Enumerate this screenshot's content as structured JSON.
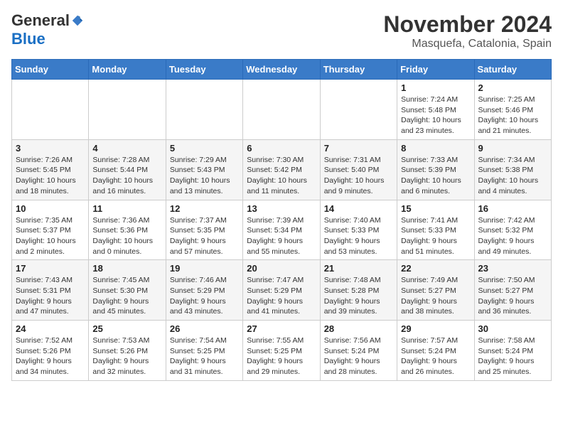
{
  "logo": {
    "general": "General",
    "blue": "Blue"
  },
  "header": {
    "month": "November 2024",
    "location": "Masquefa, Catalonia, Spain"
  },
  "weekdays": [
    "Sunday",
    "Monday",
    "Tuesday",
    "Wednesday",
    "Thursday",
    "Friday",
    "Saturday"
  ],
  "weeks": [
    [
      {
        "day": "",
        "info": ""
      },
      {
        "day": "",
        "info": ""
      },
      {
        "day": "",
        "info": ""
      },
      {
        "day": "",
        "info": ""
      },
      {
        "day": "",
        "info": ""
      },
      {
        "day": "1",
        "info": "Sunrise: 7:24 AM\nSunset: 5:48 PM\nDaylight: 10 hours and 23 minutes."
      },
      {
        "day": "2",
        "info": "Sunrise: 7:25 AM\nSunset: 5:46 PM\nDaylight: 10 hours and 21 minutes."
      }
    ],
    [
      {
        "day": "3",
        "info": "Sunrise: 7:26 AM\nSunset: 5:45 PM\nDaylight: 10 hours and 18 minutes."
      },
      {
        "day": "4",
        "info": "Sunrise: 7:28 AM\nSunset: 5:44 PM\nDaylight: 10 hours and 16 minutes."
      },
      {
        "day": "5",
        "info": "Sunrise: 7:29 AM\nSunset: 5:43 PM\nDaylight: 10 hours and 13 minutes."
      },
      {
        "day": "6",
        "info": "Sunrise: 7:30 AM\nSunset: 5:42 PM\nDaylight: 10 hours and 11 minutes."
      },
      {
        "day": "7",
        "info": "Sunrise: 7:31 AM\nSunset: 5:40 PM\nDaylight: 10 hours and 9 minutes."
      },
      {
        "day": "8",
        "info": "Sunrise: 7:33 AM\nSunset: 5:39 PM\nDaylight: 10 hours and 6 minutes."
      },
      {
        "day": "9",
        "info": "Sunrise: 7:34 AM\nSunset: 5:38 PM\nDaylight: 10 hours and 4 minutes."
      }
    ],
    [
      {
        "day": "10",
        "info": "Sunrise: 7:35 AM\nSunset: 5:37 PM\nDaylight: 10 hours and 2 minutes."
      },
      {
        "day": "11",
        "info": "Sunrise: 7:36 AM\nSunset: 5:36 PM\nDaylight: 10 hours and 0 minutes."
      },
      {
        "day": "12",
        "info": "Sunrise: 7:37 AM\nSunset: 5:35 PM\nDaylight: 9 hours and 57 minutes."
      },
      {
        "day": "13",
        "info": "Sunrise: 7:39 AM\nSunset: 5:34 PM\nDaylight: 9 hours and 55 minutes."
      },
      {
        "day": "14",
        "info": "Sunrise: 7:40 AM\nSunset: 5:33 PM\nDaylight: 9 hours and 53 minutes."
      },
      {
        "day": "15",
        "info": "Sunrise: 7:41 AM\nSunset: 5:33 PM\nDaylight: 9 hours and 51 minutes."
      },
      {
        "day": "16",
        "info": "Sunrise: 7:42 AM\nSunset: 5:32 PM\nDaylight: 9 hours and 49 minutes."
      }
    ],
    [
      {
        "day": "17",
        "info": "Sunrise: 7:43 AM\nSunset: 5:31 PM\nDaylight: 9 hours and 47 minutes."
      },
      {
        "day": "18",
        "info": "Sunrise: 7:45 AM\nSunset: 5:30 PM\nDaylight: 9 hours and 45 minutes."
      },
      {
        "day": "19",
        "info": "Sunrise: 7:46 AM\nSunset: 5:29 PM\nDaylight: 9 hours and 43 minutes."
      },
      {
        "day": "20",
        "info": "Sunrise: 7:47 AM\nSunset: 5:29 PM\nDaylight: 9 hours and 41 minutes."
      },
      {
        "day": "21",
        "info": "Sunrise: 7:48 AM\nSunset: 5:28 PM\nDaylight: 9 hours and 39 minutes."
      },
      {
        "day": "22",
        "info": "Sunrise: 7:49 AM\nSunset: 5:27 PM\nDaylight: 9 hours and 38 minutes."
      },
      {
        "day": "23",
        "info": "Sunrise: 7:50 AM\nSunset: 5:27 PM\nDaylight: 9 hours and 36 minutes."
      }
    ],
    [
      {
        "day": "24",
        "info": "Sunrise: 7:52 AM\nSunset: 5:26 PM\nDaylight: 9 hours and 34 minutes."
      },
      {
        "day": "25",
        "info": "Sunrise: 7:53 AM\nSunset: 5:26 PM\nDaylight: 9 hours and 32 minutes."
      },
      {
        "day": "26",
        "info": "Sunrise: 7:54 AM\nSunset: 5:25 PM\nDaylight: 9 hours and 31 minutes."
      },
      {
        "day": "27",
        "info": "Sunrise: 7:55 AM\nSunset: 5:25 PM\nDaylight: 9 hours and 29 minutes."
      },
      {
        "day": "28",
        "info": "Sunrise: 7:56 AM\nSunset: 5:24 PM\nDaylight: 9 hours and 28 minutes."
      },
      {
        "day": "29",
        "info": "Sunrise: 7:57 AM\nSunset: 5:24 PM\nDaylight: 9 hours and 26 minutes."
      },
      {
        "day": "30",
        "info": "Sunrise: 7:58 AM\nSunset: 5:24 PM\nDaylight: 9 hours and 25 minutes."
      }
    ]
  ]
}
